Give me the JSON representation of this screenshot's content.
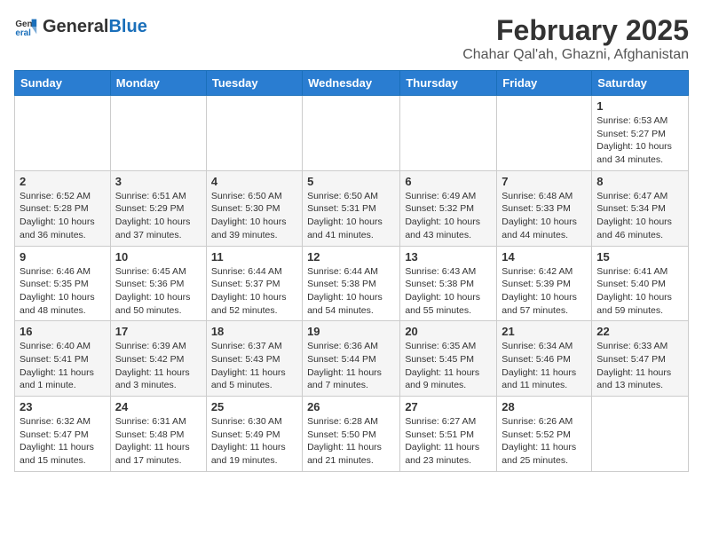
{
  "logo": {
    "general": "General",
    "blue": "Blue"
  },
  "title": "February 2025",
  "location": "Chahar Qal'ah, Ghazni, Afghanistan",
  "weekdays": [
    "Sunday",
    "Monday",
    "Tuesday",
    "Wednesday",
    "Thursday",
    "Friday",
    "Saturday"
  ],
  "weeks": [
    [
      null,
      null,
      null,
      null,
      null,
      null,
      {
        "day": 1,
        "sunrise": "6:53 AM",
        "sunset": "5:27 PM",
        "daylight": "10 hours and 34 minutes."
      }
    ],
    [
      {
        "day": 2,
        "sunrise": "6:52 AM",
        "sunset": "5:28 PM",
        "daylight": "10 hours and 36 minutes."
      },
      {
        "day": 3,
        "sunrise": "6:51 AM",
        "sunset": "5:29 PM",
        "daylight": "10 hours and 37 minutes."
      },
      {
        "day": 4,
        "sunrise": "6:50 AM",
        "sunset": "5:30 PM",
        "daylight": "10 hours and 39 minutes."
      },
      {
        "day": 5,
        "sunrise": "6:50 AM",
        "sunset": "5:31 PM",
        "daylight": "10 hours and 41 minutes."
      },
      {
        "day": 6,
        "sunrise": "6:49 AM",
        "sunset": "5:32 PM",
        "daylight": "10 hours and 43 minutes."
      },
      {
        "day": 7,
        "sunrise": "6:48 AM",
        "sunset": "5:33 PM",
        "daylight": "10 hours and 44 minutes."
      },
      {
        "day": 8,
        "sunrise": "6:47 AM",
        "sunset": "5:34 PM",
        "daylight": "10 hours and 46 minutes."
      }
    ],
    [
      {
        "day": 9,
        "sunrise": "6:46 AM",
        "sunset": "5:35 PM",
        "daylight": "10 hours and 48 minutes."
      },
      {
        "day": 10,
        "sunrise": "6:45 AM",
        "sunset": "5:36 PM",
        "daylight": "10 hours and 50 minutes."
      },
      {
        "day": 11,
        "sunrise": "6:44 AM",
        "sunset": "5:37 PM",
        "daylight": "10 hours and 52 minutes."
      },
      {
        "day": 12,
        "sunrise": "6:44 AM",
        "sunset": "5:38 PM",
        "daylight": "10 hours and 54 minutes."
      },
      {
        "day": 13,
        "sunrise": "6:43 AM",
        "sunset": "5:38 PM",
        "daylight": "10 hours and 55 minutes."
      },
      {
        "day": 14,
        "sunrise": "6:42 AM",
        "sunset": "5:39 PM",
        "daylight": "10 hours and 57 minutes."
      },
      {
        "day": 15,
        "sunrise": "6:41 AM",
        "sunset": "5:40 PM",
        "daylight": "10 hours and 59 minutes."
      }
    ],
    [
      {
        "day": 16,
        "sunrise": "6:40 AM",
        "sunset": "5:41 PM",
        "daylight": "11 hours and 1 minute."
      },
      {
        "day": 17,
        "sunrise": "6:39 AM",
        "sunset": "5:42 PM",
        "daylight": "11 hours and 3 minutes."
      },
      {
        "day": 18,
        "sunrise": "6:37 AM",
        "sunset": "5:43 PM",
        "daylight": "11 hours and 5 minutes."
      },
      {
        "day": 19,
        "sunrise": "6:36 AM",
        "sunset": "5:44 PM",
        "daylight": "11 hours and 7 minutes."
      },
      {
        "day": 20,
        "sunrise": "6:35 AM",
        "sunset": "5:45 PM",
        "daylight": "11 hours and 9 minutes."
      },
      {
        "day": 21,
        "sunrise": "6:34 AM",
        "sunset": "5:46 PM",
        "daylight": "11 hours and 11 minutes."
      },
      {
        "day": 22,
        "sunrise": "6:33 AM",
        "sunset": "5:47 PM",
        "daylight": "11 hours and 13 minutes."
      }
    ],
    [
      {
        "day": 23,
        "sunrise": "6:32 AM",
        "sunset": "5:47 PM",
        "daylight": "11 hours and 15 minutes."
      },
      {
        "day": 24,
        "sunrise": "6:31 AM",
        "sunset": "5:48 PM",
        "daylight": "11 hours and 17 minutes."
      },
      {
        "day": 25,
        "sunrise": "6:30 AM",
        "sunset": "5:49 PM",
        "daylight": "11 hours and 19 minutes."
      },
      {
        "day": 26,
        "sunrise": "6:28 AM",
        "sunset": "5:50 PM",
        "daylight": "11 hours and 21 minutes."
      },
      {
        "day": 27,
        "sunrise": "6:27 AM",
        "sunset": "5:51 PM",
        "daylight": "11 hours and 23 minutes."
      },
      {
        "day": 28,
        "sunrise": "6:26 AM",
        "sunset": "5:52 PM",
        "daylight": "11 hours and 25 minutes."
      },
      null
    ]
  ]
}
